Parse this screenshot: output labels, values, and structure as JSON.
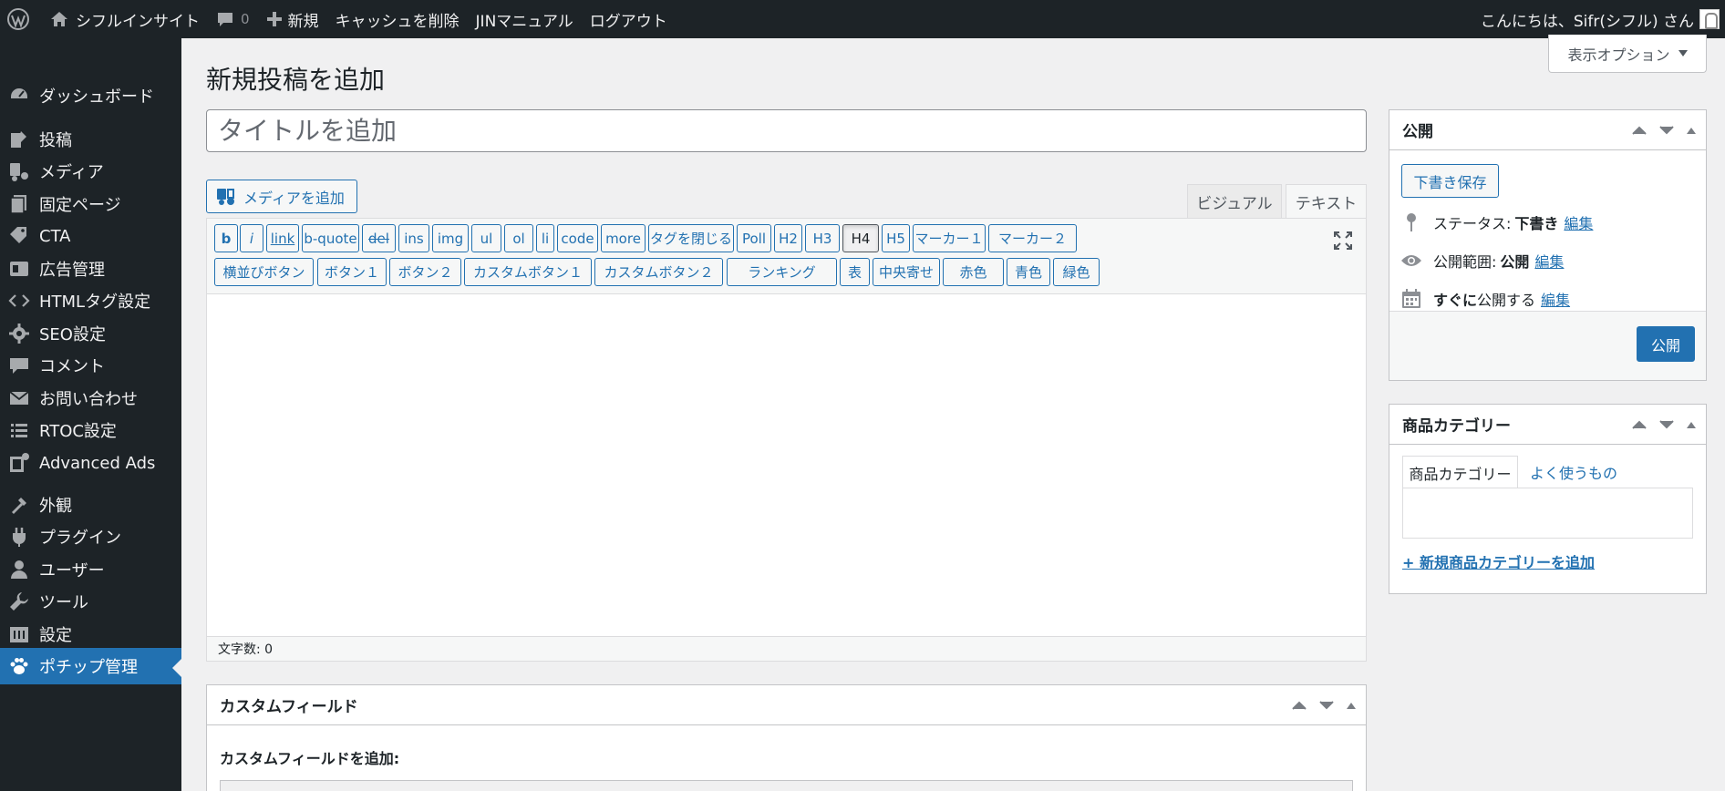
{
  "adminbar": {
    "site_name": "シフルインサイト",
    "comment_count": "0",
    "new_label": "新規",
    "clear_cache_label": "キャッシュを削除",
    "manual_label": "JINマニュアル",
    "logout_label": "ログアウト",
    "greeting": "こんにちは、Sifr(シフル) さん"
  },
  "sidebar": {
    "items": [
      {
        "label": "ダッシュボード",
        "icon": "dashboard-icon"
      },
      {
        "label": "投稿",
        "icon": "posts-icon"
      },
      {
        "label": "メディア",
        "icon": "media-icon"
      },
      {
        "label": "固定ページ",
        "icon": "pages-icon"
      },
      {
        "label": "CTA",
        "icon": "tag-icon"
      },
      {
        "label": "広告管理",
        "icon": "ads-icon"
      },
      {
        "label": "HTMLタグ設定",
        "icon": "code-icon"
      },
      {
        "label": "SEO設定",
        "icon": "gear-icon"
      },
      {
        "label": "コメント",
        "icon": "comments-icon"
      },
      {
        "label": "お問い合わせ",
        "icon": "mail-icon"
      },
      {
        "label": "RTOC設定",
        "icon": "list-icon"
      },
      {
        "label": "Advanced Ads",
        "icon": "advanced-ads-icon"
      },
      {
        "label": "外観",
        "icon": "appearance-icon"
      },
      {
        "label": "プラグイン",
        "icon": "plugins-icon"
      },
      {
        "label": "ユーザー",
        "icon": "users-icon"
      },
      {
        "label": "ツール",
        "icon": "tools-icon"
      },
      {
        "label": "設定",
        "icon": "settings-icon"
      },
      {
        "label": "ポチップ管理",
        "icon": "paw-icon",
        "current": true
      }
    ]
  },
  "main": {
    "page_title": "新規投稿を追加",
    "screen_options_label": "表示オプション",
    "title_placeholder": "タイトルを追加",
    "add_media_label": "メディアを追加",
    "tab_visual": "ビジュアル",
    "tab_text": "テキスト",
    "quicktags_row1": [
      "b",
      "i",
      "link",
      "b-quote",
      "del",
      "ins",
      "img",
      "ul",
      "ol",
      "li",
      "code",
      "more",
      "タグを閉じる",
      "Poll",
      "H2",
      "H3",
      "H4",
      "H5",
      "マーカー１",
      "マーカー２"
    ],
    "quicktags_row2": [
      "横並びボタン",
      "ボタン１",
      "ボタン２",
      "カスタムボタン１",
      "カスタムボタン２",
      "ランキング",
      "表",
      "中央寄せ",
      "赤色",
      "青色",
      "緑色"
    ],
    "active_quicktag": "H4",
    "word_count_label": "文字数: 0",
    "editor_content": ""
  },
  "custom_fields": {
    "title": "カスタムフィールド",
    "add_label": "カスタムフィールドを追加:"
  },
  "publish": {
    "title": "公開",
    "save_draft_label": "下書き保存",
    "status_label": "ステータス:",
    "status_value": "下書き",
    "visibility_label": "公開範囲:",
    "visibility_value": "公開",
    "schedule_prefix": "すぐに",
    "schedule_suffix": "公開する",
    "edit_label": "編集",
    "publish_label": "公開"
  },
  "category": {
    "title": "商品カテゴリー",
    "tab_all": "商品カテゴリー",
    "tab_popular": "よく使うもの",
    "add_new_label": "+ 新規商品カテゴリーを追加"
  },
  "colors": {
    "admin_dark": "#1d2327",
    "accent": "#2271b1",
    "background": "#f0f0f1"
  }
}
